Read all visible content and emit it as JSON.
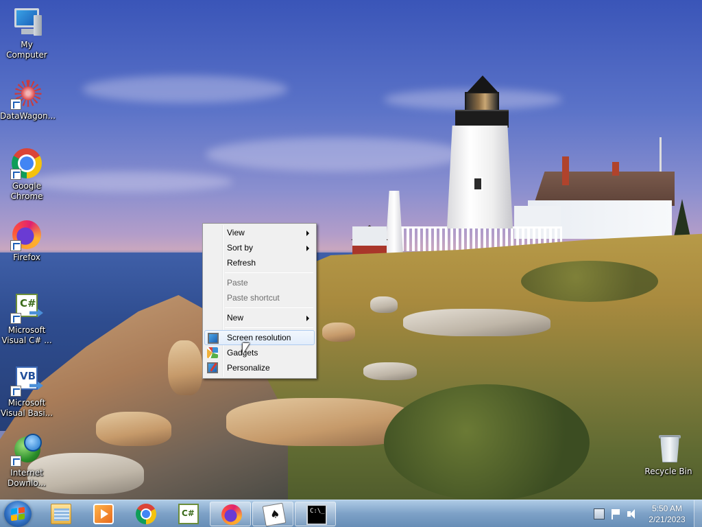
{
  "desktop": {
    "icons": [
      {
        "label": "My Computer",
        "icon": "computer-icon"
      },
      {
        "label": "DataWagon...",
        "icon": "datawagon-icon"
      },
      {
        "label": "Google Chrome",
        "icon": "chrome-icon"
      },
      {
        "label": "Firefox",
        "icon": "firefox-icon"
      },
      {
        "label": "Microsoft Visual C# ...",
        "icon": "visual-csharp-icon",
        "glyph": "C#"
      },
      {
        "label": "Microsoft Visual Basi...",
        "icon": "visual-basic-icon",
        "glyph": "VB"
      },
      {
        "label": "Internet Downlo...",
        "icon": "internet-download-icon"
      },
      {
        "label": "Recycle Bin",
        "icon": "recycle-bin-icon"
      }
    ]
  },
  "context_menu": {
    "items": [
      {
        "label": "View",
        "has_submenu": true,
        "enabled": true
      },
      {
        "label": "Sort by",
        "has_submenu": true,
        "enabled": true
      },
      {
        "label": "Refresh",
        "enabled": true
      },
      {
        "label": "Paste",
        "enabled": false
      },
      {
        "label": "Paste shortcut",
        "enabled": false
      },
      {
        "label": "New",
        "has_submenu": true,
        "enabled": true
      },
      {
        "label": "Screen resolution",
        "icon": "screen-resolution-icon",
        "enabled": true,
        "highlighted": true
      },
      {
        "label": "Gadgets",
        "icon": "gadgets-icon",
        "enabled": true
      },
      {
        "label": "Personalize",
        "icon": "personalize-icon",
        "enabled": true
      }
    ]
  },
  "taskbar": {
    "start": {
      "icon": "windows-logo-icon"
    },
    "buttons": [
      {
        "icon": "file-explorer-icon"
      },
      {
        "icon": "media-player-icon"
      },
      {
        "icon": "chrome-icon"
      },
      {
        "icon": "visual-csharp-icon",
        "glyph": "C#"
      },
      {
        "icon": "firefox-icon",
        "open": true
      },
      {
        "icon": "solitaire-icon",
        "open": true
      },
      {
        "icon": "command-prompt-icon",
        "glyph": "C:\\_",
        "open": true
      }
    ],
    "tray": {
      "icons": [
        "action-center-icon",
        "flag-icon",
        "volume-icon"
      ],
      "time": "5:50 AM",
      "date": "2/21/2023"
    }
  }
}
